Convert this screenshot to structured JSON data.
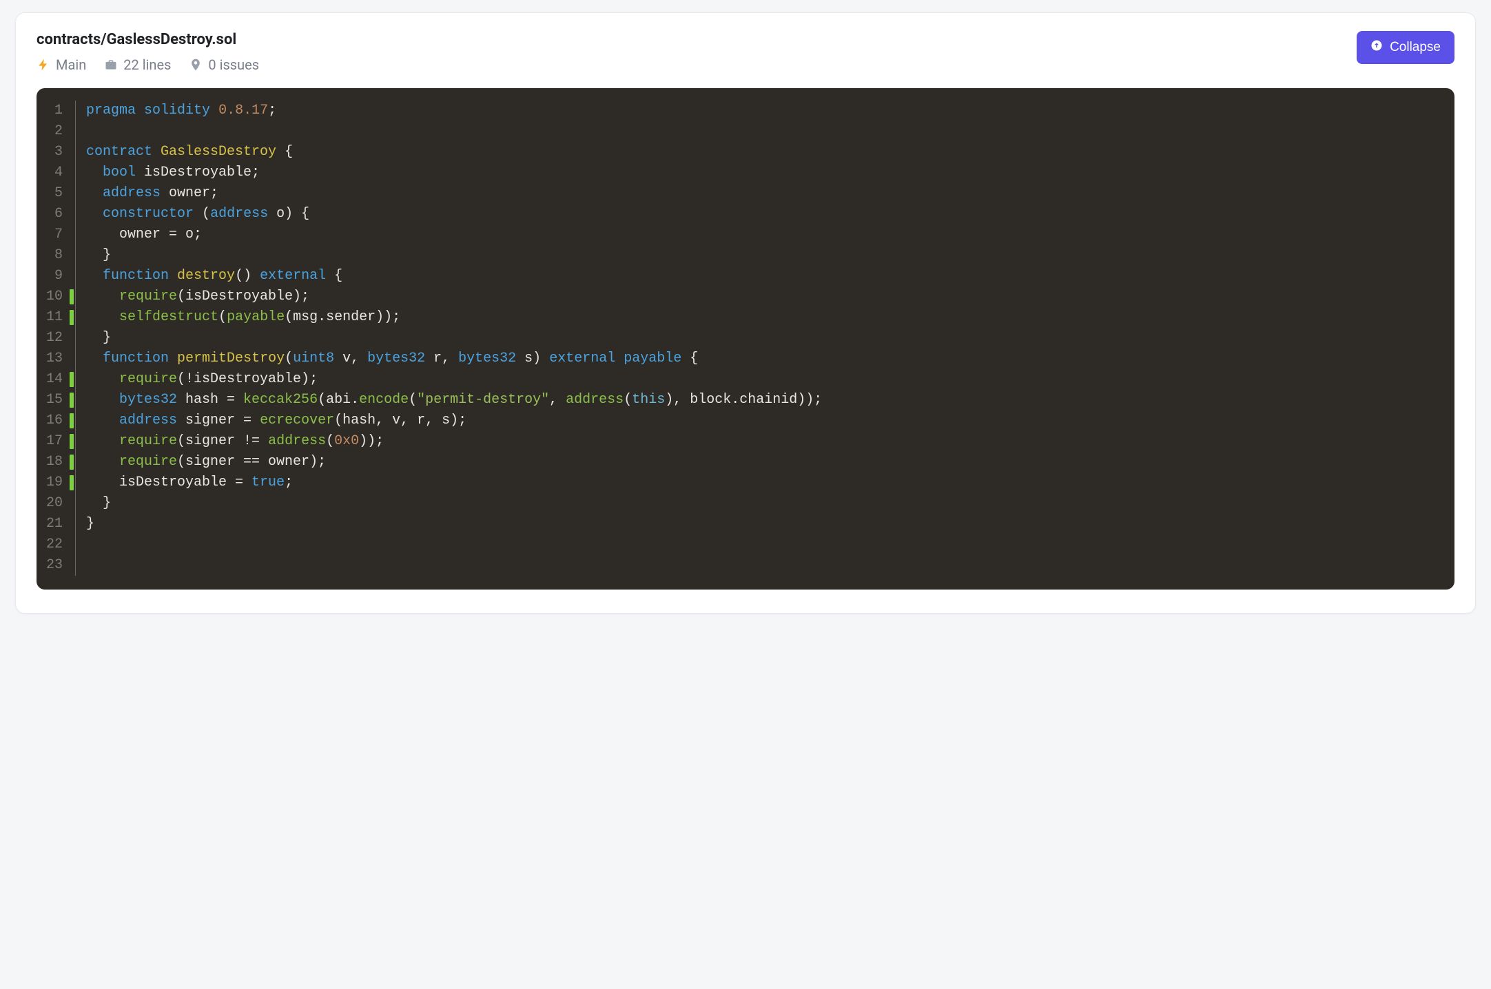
{
  "file": {
    "path": "contracts/GaslessDestroy.sol"
  },
  "meta": {
    "main_label": "Main",
    "lines_label": "22 lines",
    "issues_label": "0 issues"
  },
  "actions": {
    "collapse_label": "Collapse"
  },
  "code": {
    "total_lines": 23,
    "lines": [
      {
        "n": 1,
        "marker": false,
        "tokens": [
          [
            "kw",
            "pragma"
          ],
          [
            "ident",
            " "
          ],
          [
            "kw",
            "solidity"
          ],
          [
            "ident",
            " "
          ],
          [
            "num",
            "0.8.17"
          ],
          [
            "ident",
            ";"
          ]
        ]
      },
      {
        "n": 2,
        "marker": false,
        "tokens": [
          [
            "ident",
            ""
          ]
        ]
      },
      {
        "n": 3,
        "marker": false,
        "tokens": [
          [
            "kw",
            "contract"
          ],
          [
            "ident",
            " "
          ],
          [
            "name",
            "GaslessDestroy"
          ],
          [
            "ident",
            " {"
          ]
        ]
      },
      {
        "n": 4,
        "marker": false,
        "tokens": [
          [
            "ident",
            "  "
          ],
          [
            "kw",
            "bool"
          ],
          [
            "ident",
            " isDestroyable;"
          ]
        ]
      },
      {
        "n": 5,
        "marker": false,
        "tokens": [
          [
            "ident",
            "  "
          ],
          [
            "kw",
            "address"
          ],
          [
            "ident",
            " owner;"
          ]
        ]
      },
      {
        "n": 6,
        "marker": false,
        "tokens": [
          [
            "ident",
            "  "
          ],
          [
            "kw",
            "constructor"
          ],
          [
            "ident",
            " ("
          ],
          [
            "kw",
            "address"
          ],
          [
            "ident",
            " o) {"
          ]
        ]
      },
      {
        "n": 7,
        "marker": false,
        "tokens": [
          [
            "ident",
            "    owner = o;"
          ]
        ]
      },
      {
        "n": 8,
        "marker": false,
        "tokens": [
          [
            "ident",
            "  }"
          ]
        ]
      },
      {
        "n": 9,
        "marker": false,
        "tokens": [
          [
            "ident",
            "  "
          ],
          [
            "kw",
            "function"
          ],
          [
            "ident",
            " "
          ],
          [
            "name",
            "destroy"
          ],
          [
            "ident",
            "() "
          ],
          [
            "kw",
            "external"
          ],
          [
            "ident",
            " {"
          ]
        ]
      },
      {
        "n": 10,
        "marker": true,
        "tokens": [
          [
            "ident",
            "    "
          ],
          [
            "fn",
            "require"
          ],
          [
            "ident",
            "(isDestroyable);"
          ]
        ]
      },
      {
        "n": 11,
        "marker": true,
        "tokens": [
          [
            "ident",
            "    "
          ],
          [
            "fn",
            "selfdestruct"
          ],
          [
            "ident",
            "("
          ],
          [
            "fn",
            "payable"
          ],
          [
            "ident",
            "(msg.sender));"
          ]
        ]
      },
      {
        "n": 12,
        "marker": false,
        "tokens": [
          [
            "ident",
            "  }"
          ]
        ]
      },
      {
        "n": 13,
        "marker": false,
        "tokens": [
          [
            "ident",
            "  "
          ],
          [
            "kw",
            "function"
          ],
          [
            "ident",
            " "
          ],
          [
            "name",
            "permitDestroy"
          ],
          [
            "ident",
            "("
          ],
          [
            "kw",
            "uint8"
          ],
          [
            "ident",
            " v, "
          ],
          [
            "kw",
            "bytes32"
          ],
          [
            "ident",
            " r, "
          ],
          [
            "kw",
            "bytes32"
          ],
          [
            "ident",
            " s) "
          ],
          [
            "kw",
            "external"
          ],
          [
            "ident",
            " "
          ],
          [
            "kw",
            "payable"
          ],
          [
            "ident",
            " {"
          ]
        ]
      },
      {
        "n": 14,
        "marker": true,
        "tokens": [
          [
            "ident",
            "    "
          ],
          [
            "fn",
            "require"
          ],
          [
            "ident",
            "(!isDestroyable);"
          ]
        ]
      },
      {
        "n": 15,
        "marker": true,
        "tokens": [
          [
            "ident",
            "    "
          ],
          [
            "kw",
            "bytes32"
          ],
          [
            "ident",
            " hash = "
          ],
          [
            "fn",
            "keccak256"
          ],
          [
            "ident",
            "(abi."
          ],
          [
            "fn",
            "encode"
          ],
          [
            "ident",
            "("
          ],
          [
            "str",
            "\"permit-destroy\""
          ],
          [
            "ident",
            ", "
          ],
          [
            "fn",
            "address"
          ],
          [
            "ident",
            "("
          ],
          [
            "builtin",
            "this"
          ],
          [
            "ident",
            "), block.chainid));"
          ]
        ]
      },
      {
        "n": 16,
        "marker": true,
        "tokens": [
          [
            "ident",
            "    "
          ],
          [
            "kw",
            "address"
          ],
          [
            "ident",
            " signer = "
          ],
          [
            "fn",
            "ecrecover"
          ],
          [
            "ident",
            "(hash, v, r, s);"
          ]
        ]
      },
      {
        "n": 17,
        "marker": true,
        "tokens": [
          [
            "ident",
            "    "
          ],
          [
            "fn",
            "require"
          ],
          [
            "ident",
            "(signer != "
          ],
          [
            "fn",
            "address"
          ],
          [
            "ident",
            "("
          ],
          [
            "num",
            "0x0"
          ],
          [
            "ident",
            "));"
          ]
        ]
      },
      {
        "n": 18,
        "marker": true,
        "tokens": [
          [
            "ident",
            "    "
          ],
          [
            "fn",
            "require"
          ],
          [
            "ident",
            "(signer == owner);"
          ]
        ]
      },
      {
        "n": 19,
        "marker": true,
        "tokens": [
          [
            "ident",
            "    isDestroyable = "
          ],
          [
            "kw",
            "true"
          ],
          [
            "ident",
            ";"
          ]
        ]
      },
      {
        "n": 20,
        "marker": false,
        "tokens": [
          [
            "ident",
            "  }"
          ]
        ]
      },
      {
        "n": 21,
        "marker": false,
        "tokens": [
          [
            "ident",
            "}"
          ]
        ]
      },
      {
        "n": 22,
        "marker": false,
        "tokens": [
          [
            "ident",
            ""
          ]
        ]
      },
      {
        "n": 23,
        "marker": false,
        "tokens": [
          [
            "ident",
            ""
          ]
        ]
      }
    ]
  }
}
